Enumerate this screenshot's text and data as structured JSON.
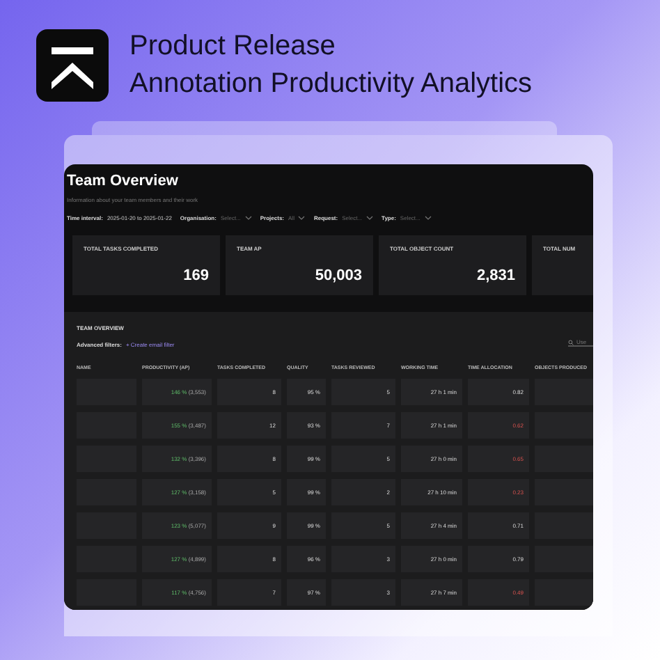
{
  "header": {
    "title_line_1": "Product Release",
    "title_line_2": "Annotation Productivity Analytics"
  },
  "panel": {
    "title": "Team Overview",
    "subtitle": "Information about your team members and their work",
    "filters": [
      {
        "label": "Time interval:",
        "value": "2025-01-20 to 2025-01-22",
        "dropdown": false
      },
      {
        "label": "Organisation:",
        "value": "Select...",
        "dropdown": true
      },
      {
        "label": "Projects:",
        "value": "All",
        "dropdown": true
      },
      {
        "label": "Request:",
        "value": "Select...",
        "dropdown": true
      },
      {
        "label": "Type:",
        "value": "Select...",
        "dropdown": true
      }
    ],
    "stats": [
      {
        "label": "TOTAL TASKS COMPLETED",
        "value": "169"
      },
      {
        "label": "TEAM AP",
        "value": "50,003"
      },
      {
        "label": "TOTAL OBJECT COUNT",
        "value": "2,831"
      },
      {
        "label": "TOTAL NUM"
      }
    ]
  },
  "table": {
    "title": "TEAM OVERVIEW",
    "advanced_filters_label": "Advanced filters:",
    "create_filter_link": "+ Create email filter",
    "search": {
      "placeholder": "Use"
    },
    "columns": [
      "NAME",
      "PRODUCTIVITY (AP)",
      "TASKS COMPLETED",
      "QUALITY",
      "TASKS REVIEWED",
      "WORKING TIME",
      "TIME ALLOCATION",
      "OBJECTS PRODUCED"
    ],
    "rows": [
      {
        "productivity": "146 %",
        "ap": "(3,553)",
        "tasks": "8",
        "quality": "95 %",
        "reviewed": "5",
        "time": "27 h 1 min",
        "allocation": "0.82",
        "low": false
      },
      {
        "productivity": "155 %",
        "ap": "(3,487)",
        "tasks": "12",
        "quality": "93 %",
        "reviewed": "7",
        "time": "27 h 1 min",
        "allocation": "0.62",
        "low": true
      },
      {
        "productivity": "132 %",
        "ap": "(3,396)",
        "tasks": "8",
        "quality": "99 %",
        "reviewed": "5",
        "time": "27 h 0 min",
        "allocation": "0.65",
        "low": true
      },
      {
        "productivity": "127 %",
        "ap": "(3,158)",
        "tasks": "5",
        "quality": "99 %",
        "reviewed": "2",
        "time": "27 h 10 min",
        "allocation": "0.23",
        "low": true
      },
      {
        "productivity": "123 %",
        "ap": "(5,077)",
        "tasks": "9",
        "quality": "99 %",
        "reviewed": "5",
        "time": "27 h 4 min",
        "allocation": "0.71",
        "low": false
      },
      {
        "productivity": "127 %",
        "ap": "(4,899)",
        "tasks": "8",
        "quality": "96 %",
        "reviewed": "3",
        "time": "27 h 0 min",
        "allocation": "0.79",
        "low": false
      },
      {
        "productivity": "117 %",
        "ap": "(4,756)",
        "tasks": "7",
        "quality": "97 %",
        "reviewed": "3",
        "time": "27 h 7 min",
        "allocation": "0.49",
        "low": true
      }
    ]
  }
}
